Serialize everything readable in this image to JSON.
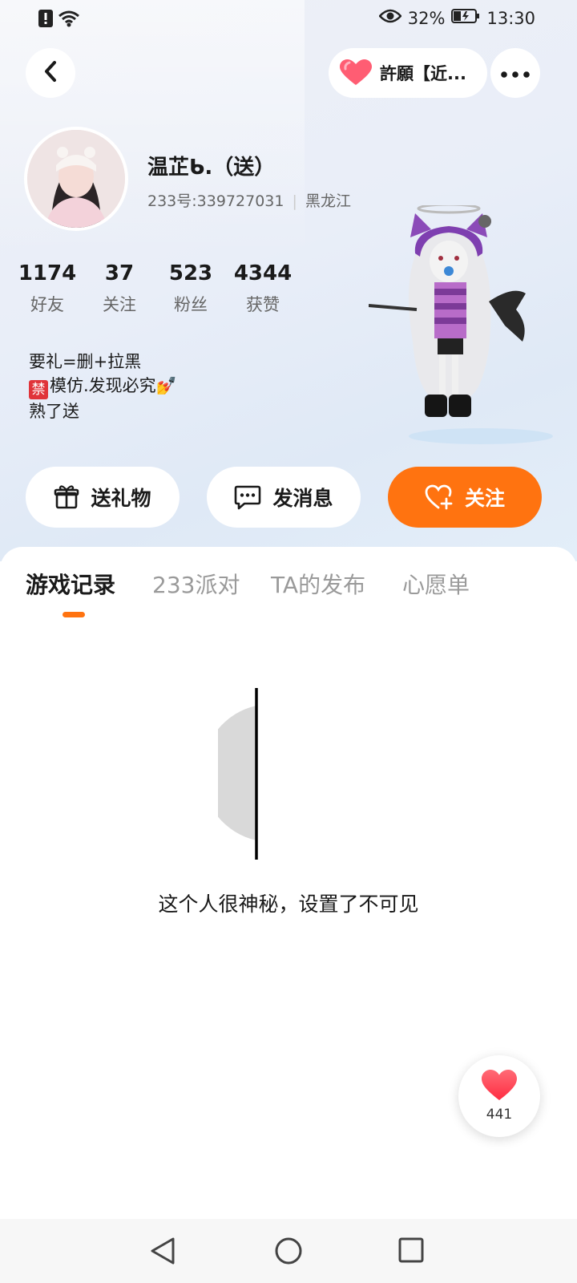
{
  "status_bar": {
    "battery": "32%",
    "time": "13:30",
    "icons": [
      "alert-icon",
      "wifi-icon",
      "eye-icon",
      "battery-icon"
    ]
  },
  "header": {
    "back_icon": "chevron-left-icon",
    "wish_label": "許願【近...",
    "wish_icon": "heart-icon",
    "more_icon": "more-dots-icon"
  },
  "profile": {
    "name": "温芷ᑲ.（送）",
    "id_line": "233号:339727031",
    "region": "黑龙江",
    "stats": [
      {
        "value": "1174",
        "label": "好友"
      },
      {
        "value": "37",
        "label": "关注"
      },
      {
        "value": "523",
        "label": "粉丝"
      },
      {
        "value": "4344",
        "label": "获赞"
      }
    ],
    "bio_line1": "要礼=删+拉黑",
    "bio_ban_mark": "禁",
    "bio_line2": "模仿.发现必究💅",
    "bio_line3": "熟了送"
  },
  "actions": {
    "gift_label": "送礼物",
    "message_label": "发消息",
    "follow_label": "关注"
  },
  "tabs": [
    {
      "label": "游戏记录",
      "active": true
    },
    {
      "label": "233派对",
      "active": false
    },
    {
      "label": "TA的发布",
      "active": false
    },
    {
      "label": "心愿单",
      "active": false
    }
  ],
  "empty_state": {
    "message": "这个人很神秘，设置了不可见"
  },
  "floating_like": {
    "count": "441"
  },
  "colors": {
    "accent": "#ff7310",
    "heart": "#ff3b4e"
  }
}
